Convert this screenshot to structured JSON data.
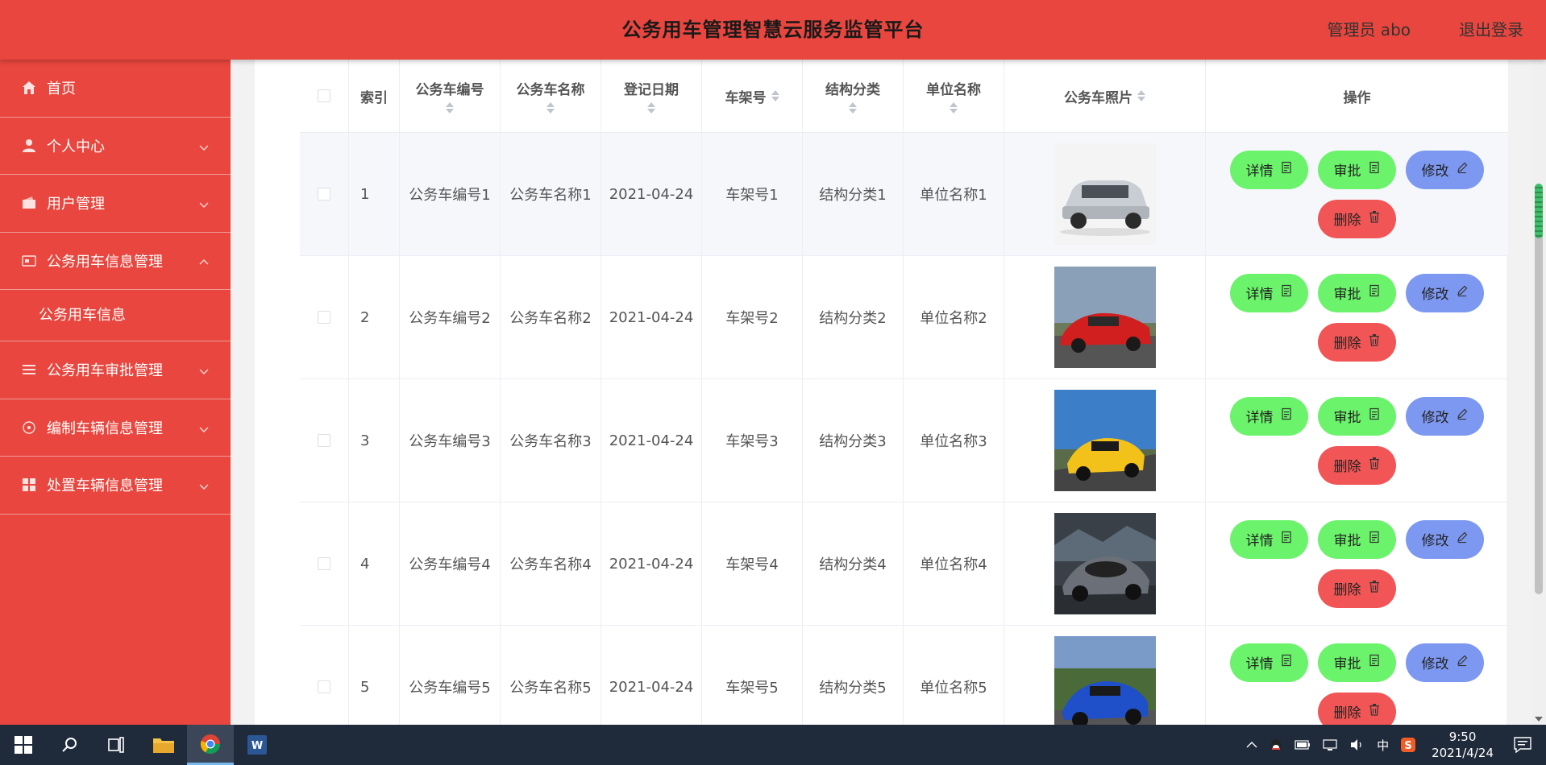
{
  "header": {
    "title": "公务用车管理智慧云服务监管平台",
    "user": "管理员 abo",
    "logout": "退出登录"
  },
  "sidebar": {
    "items": [
      {
        "label": "首页",
        "icon": "home-icon"
      },
      {
        "label": "个人中心",
        "icon": "person-icon"
      },
      {
        "label": "用户管理",
        "icon": "wallet-icon"
      },
      {
        "label": "公务用车信息管理",
        "icon": "card-icon",
        "expanded": true,
        "children": [
          {
            "label": "公务用车信息"
          }
        ]
      },
      {
        "label": "公务用车审批管理",
        "icon": "list-icon"
      },
      {
        "label": "编制车辆信息管理",
        "icon": "compass-icon"
      },
      {
        "label": "处置车辆信息管理",
        "icon": "grid-icon"
      }
    ]
  },
  "table": {
    "headers": {
      "index": "索引",
      "code": "公务车编号",
      "name": "公务车名称",
      "date": "登记日期",
      "frame": "车架号",
      "structure": "结构分类",
      "unit": "单位名称",
      "photo": "公务车照片",
      "ops": "操作"
    },
    "rows": [
      {
        "index": "1",
        "code": "公务车编号1",
        "name": "公务车名称1",
        "date": "2021-04-24",
        "frame": "车架号1",
        "structure": "结构分类1",
        "unit": "单位名称1",
        "photo": "suv-white"
      },
      {
        "index": "2",
        "code": "公务车编号2",
        "name": "公务车名称2",
        "date": "2021-04-24",
        "frame": "车架号2",
        "structure": "结构分类2",
        "unit": "单位名称2",
        "photo": "sports-red"
      },
      {
        "index": "3",
        "code": "公务车编号3",
        "name": "公务车名称3",
        "date": "2021-04-24",
        "frame": "车架号3",
        "structure": "结构分类3",
        "unit": "单位名称3",
        "photo": "sports-yellow"
      },
      {
        "index": "4",
        "code": "公务车编号4",
        "name": "公务车名称4",
        "date": "2021-04-24",
        "frame": "车架号4",
        "structure": "结构分类4",
        "unit": "单位名称4",
        "photo": "concept-grey"
      },
      {
        "index": "5",
        "code": "公务车编号5",
        "name": "公务车名称5",
        "date": "2021-04-24",
        "frame": "车架号5",
        "structure": "结构分类5",
        "unit": "单位名称5",
        "photo": "sports-blue"
      }
    ],
    "actions": {
      "detail": "详情",
      "approve": "审批",
      "edit": "修改",
      "delete": "删除"
    }
  },
  "colors": {
    "primary": "#e8463e",
    "btn_green": "#6bf36b",
    "btn_blue": "#7d98f0",
    "btn_red": "#f25555"
  },
  "taskbar": {
    "ime": "中",
    "time": "9:50",
    "date": "2021/4/24"
  }
}
